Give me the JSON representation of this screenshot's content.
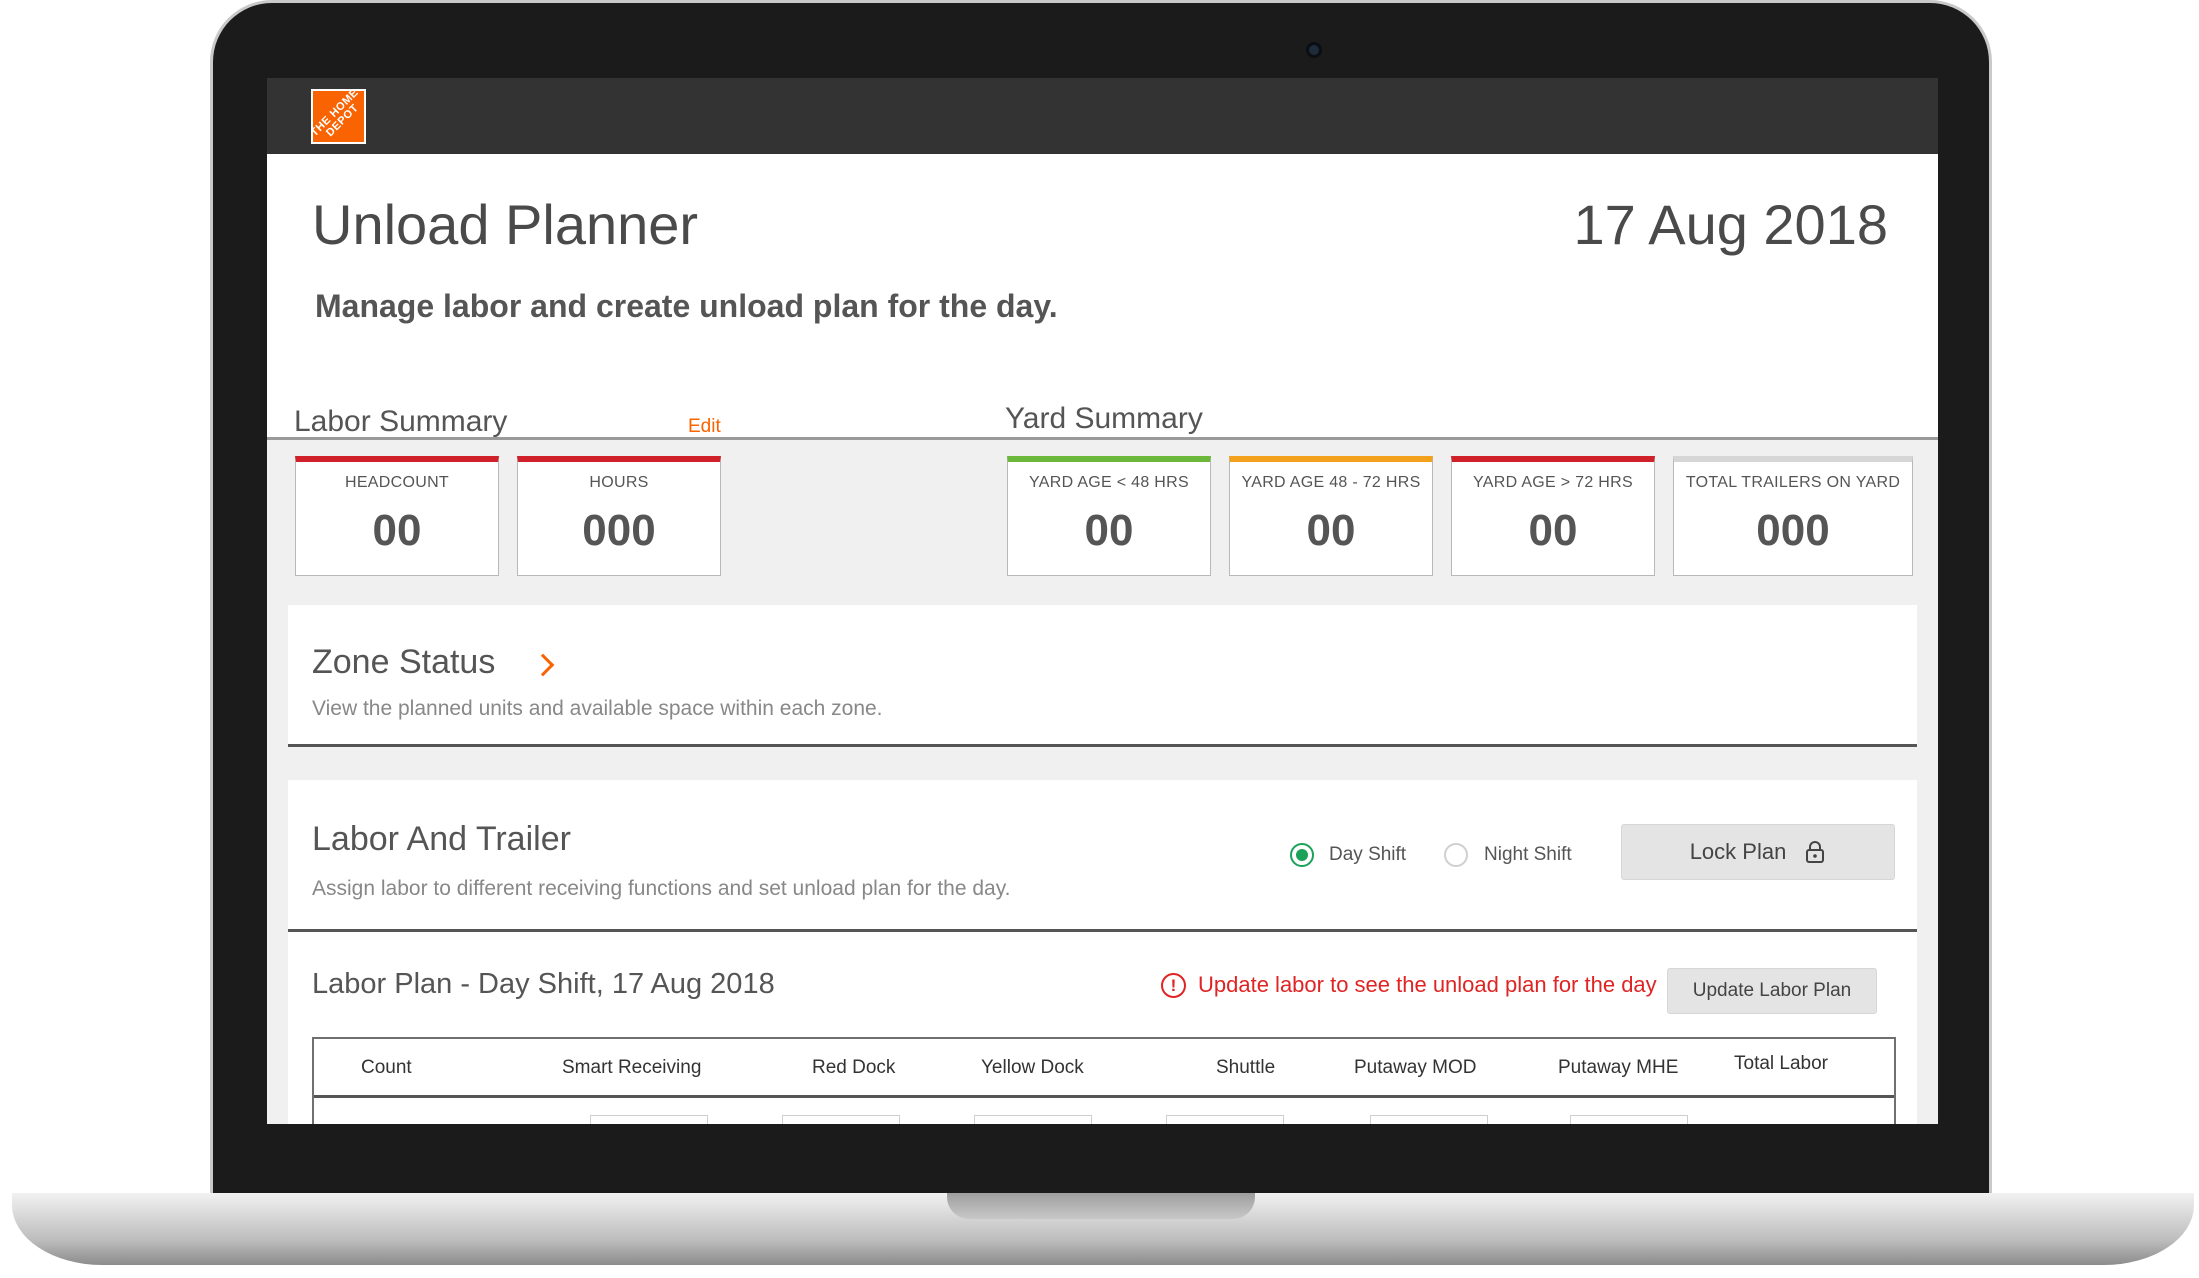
{
  "app": {
    "logo_text": "THE HOME DEPOT",
    "brand_color": "#f96302"
  },
  "header": {
    "title": "Unload Planner",
    "date": "17 Aug 2018",
    "subtitle": "Manage labor and create unload plan for the day."
  },
  "labor_summary": {
    "title": "Labor Summary",
    "edit_label": "Edit",
    "cards": [
      {
        "label": "HEADCOUNT",
        "value": "00",
        "accent": "#d0212b"
      },
      {
        "label": "HOURS",
        "value": "000",
        "accent": "#d0212b"
      }
    ]
  },
  "yard_summary": {
    "title": "Yard Summary",
    "cards": [
      {
        "label": "YARD AGE  < 48  HRS",
        "value": "00",
        "accent": "#6bb83a"
      },
      {
        "label": "YARD AGE  48 - 72  HRS",
        "value": "00",
        "accent": "#f4a21e"
      },
      {
        "label": "YARD AGE  > 72  HRS",
        "value": "00",
        "accent": "#d0212b"
      },
      {
        "label": "TOTAL TRAILERS ON YARD",
        "value": "000",
        "accent": "#d6d6d6"
      }
    ]
  },
  "zone_status": {
    "title": "Zone Status",
    "description": "View the planned units and available space within each zone.",
    "chevron_icon": "chevron-right-icon"
  },
  "labor_trailer": {
    "title": "Labor And Trailer",
    "description": "Assign labor to different receiving functions and set unload plan for the day.",
    "shift_options": [
      {
        "label": "Day Shift",
        "selected": true
      },
      {
        "label": "Night Shift",
        "selected": false
      }
    ],
    "lock_button": "Lock Plan",
    "lock_icon": "lock-icon"
  },
  "labor_plan": {
    "title": "Labor Plan - Day Shift, 17 Aug 2018",
    "warning": "Update labor to see the unload plan for the day",
    "warning_icon": "alert-circle-icon",
    "update_button": "Update Labor Plan",
    "columns": [
      "Count",
      "Smart Receiving",
      "Red Dock",
      "Yellow Dock",
      "Shuttle",
      "Putaway MOD",
      "Putaway MHE",
      "Total Labor"
    ]
  }
}
